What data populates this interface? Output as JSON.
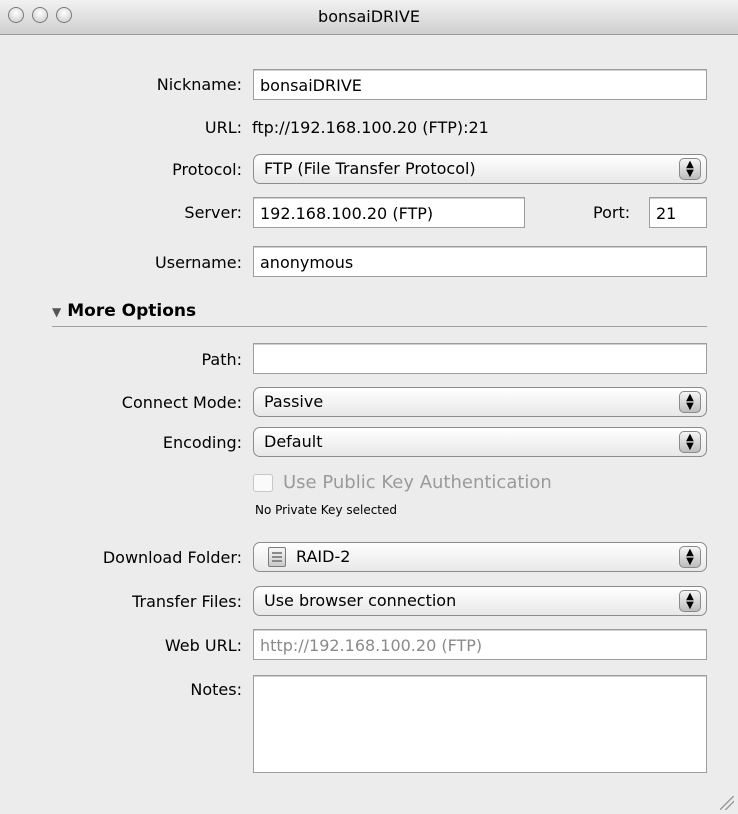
{
  "window": {
    "title": "bonsaiDRIVE"
  },
  "form": {
    "nickname": {
      "label": "Nickname:",
      "value": "bonsaiDRIVE"
    },
    "url": {
      "label": "URL:",
      "value": "ftp://192.168.100.20 (FTP):21"
    },
    "protocol": {
      "label": "Protocol:",
      "value": "FTP (File Transfer Protocol)"
    },
    "server": {
      "label": "Server:",
      "value": "192.168.100.20 (FTP)"
    },
    "port": {
      "label": "Port:",
      "value": "21"
    },
    "username": {
      "label": "Username:",
      "value": "anonymous"
    },
    "more_options": {
      "label": "More Options"
    },
    "path": {
      "label": "Path:",
      "value": ""
    },
    "connect_mode": {
      "label": "Connect Mode:",
      "value": "Passive"
    },
    "encoding": {
      "label": "Encoding:",
      "value": "Default"
    },
    "public_key": {
      "label": "Use Public Key Authentication",
      "note": "No Private Key selected"
    },
    "download_folder": {
      "label": "Download Folder:",
      "value": "RAID-2"
    },
    "transfer_files": {
      "label": "Transfer Files:",
      "value": "Use browser connection"
    },
    "web_url": {
      "label": "Web URL:",
      "placeholder": "http://192.168.100.20 (FTP)"
    },
    "notes": {
      "label": "Notes:",
      "value": ""
    }
  }
}
